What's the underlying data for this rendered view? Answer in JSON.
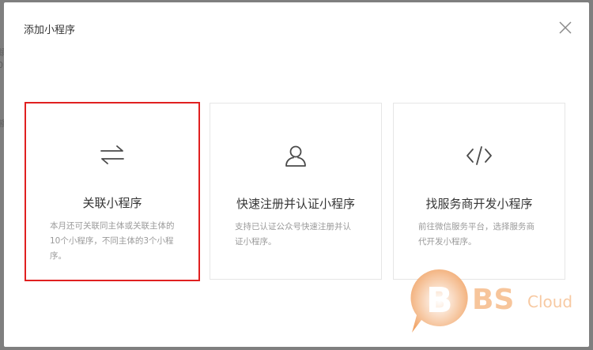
{
  "background": {
    "fragments": [
      "頫",
      "0",
      "赣"
    ]
  },
  "modal": {
    "title": "添加小程序",
    "close_icon": "close-icon",
    "cards": [
      {
        "title": "关联小程序",
        "description": "本月还可关联同主体或关联主体的10个小程序，不同主体的3个小程序。",
        "icon": "swap-arrows-icon",
        "selected": true
      },
      {
        "title": "快速注册并认证小程序",
        "description": "支持已认证公众号快速注册并认证小程序。",
        "icon": "user-icon",
        "selected": false
      },
      {
        "title": "找服务商开发小程序",
        "description": "前往微信服务平台，选择服务商代开发小程序。",
        "icon": "code-icon",
        "selected": false
      }
    ]
  },
  "watermark": {
    "letters": "BS",
    "word": "Cloud"
  },
  "colors": {
    "selected_border": "#e02020",
    "watermark_orange": "#f0a060"
  }
}
